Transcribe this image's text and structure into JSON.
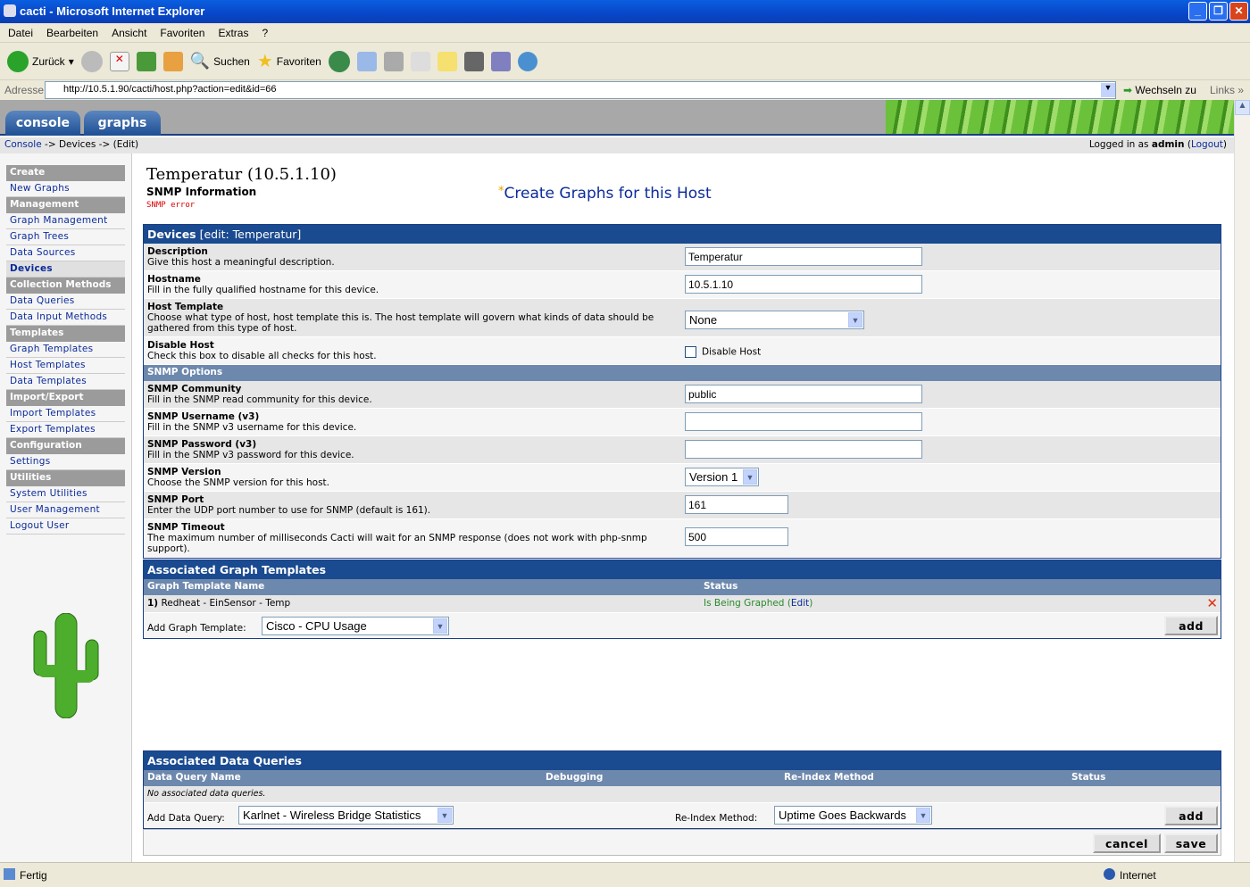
{
  "window": {
    "title": "cacti - Microsoft Internet Explorer",
    "controls": [
      "_",
      "❐",
      "✕"
    ]
  },
  "menu": [
    "Datei",
    "Bearbeiten",
    "Ansicht",
    "Favoriten",
    "Extras",
    "?"
  ],
  "toolbar": {
    "back": "Zurück",
    "search": "Suchen",
    "favorites": "Favoriten"
  },
  "address": {
    "label": "Adresse",
    "url": "http://10.5.1.90/cacti/host.php?action=edit&id=66",
    "go": "Wechseln zu",
    "links": "Links"
  },
  "tabs": [
    "console",
    "graphs"
  ],
  "breadcrumb": {
    "root": "Console",
    "rest": " -> Devices -> (Edit)",
    "logged_prefix": "Logged in as ",
    "user": "admin",
    "logout": "Logout"
  },
  "sidebar": [
    {
      "h": "Create"
    },
    {
      "i": "New Graphs"
    },
    {
      "h": "Management"
    },
    {
      "i": "Graph Management"
    },
    {
      "i": "Graph Trees"
    },
    {
      "i": "Data Sources"
    },
    {
      "i": "Devices",
      "active": true
    },
    {
      "h": "Collection Methods"
    },
    {
      "i": "Data Queries"
    },
    {
      "i": "Data Input Methods"
    },
    {
      "h": "Templates"
    },
    {
      "i": "Graph Templates"
    },
    {
      "i": "Host Templates"
    },
    {
      "i": "Data Templates"
    },
    {
      "h": "Import/Export"
    },
    {
      "i": "Import Templates"
    },
    {
      "i": "Export Templates"
    },
    {
      "h": "Configuration"
    },
    {
      "i": "Settings"
    },
    {
      "h": "Utilities"
    },
    {
      "i": "System Utilities"
    },
    {
      "i": "User Management"
    },
    {
      "i": "Logout User"
    }
  ],
  "page": {
    "title": "Temperatur (10.5.1.10)",
    "snmp_info": "SNMP Information",
    "snmp_error": "SNMP error",
    "create_star": "*",
    "create_link": "Create Graphs for this Host"
  },
  "devices": {
    "title": "Devices",
    "subtitle": " [edit: Temperatur]",
    "snmp_header": "SNMP Options",
    "fields": [
      {
        "t": "Description",
        "d": "Give this host a meaningful description.",
        "type": "text",
        "value": "Temperatur",
        "w": 266
      },
      {
        "t": "Hostname",
        "d": "Fill in the fully qualified hostname for this device.",
        "type": "text",
        "value": "10.5.1.10",
        "w": 266
      },
      {
        "t": "Host Template",
        "d": "Choose what type of host, host template this is. The host template will govern what kinds of data should be gathered from this type of host.",
        "type": "select",
        "value": "None",
        "w": 201
      },
      {
        "t": "Disable Host",
        "d": "Check this box to disable all checks for this host.",
        "type": "checkbox",
        "value": "Disable Host",
        "checked": false
      },
      {
        "t": "SNMP Community",
        "d": "Fill in the SNMP read community for this device.",
        "type": "text",
        "value": "public",
        "w": 266
      },
      {
        "t": "SNMP Username (v3)",
        "d": "Fill in the SNMP v3 username for this device.",
        "type": "text",
        "value": "",
        "w": 266
      },
      {
        "t": "SNMP Password (v3)",
        "d": "Fill in the SNMP v3 password for this device.",
        "type": "text",
        "value": "",
        "w": 266
      },
      {
        "t": "SNMP Version",
        "d": "Choose the SNMP version for this host.",
        "type": "select",
        "value": "Version 1",
        "w": 83
      },
      {
        "t": "SNMP Port",
        "d": "Enter the UDP port number to use for SNMP (default is 161).",
        "type": "text",
        "value": "161",
        "w": 116
      },
      {
        "t": "SNMP Timeout",
        "d": "The maximum number of milliseconds Cacti will wait for an SNMP response (does not work with php-snmp support).",
        "type": "text",
        "value": "500",
        "w": 116
      }
    ]
  },
  "graph_templates": {
    "title": "Associated Graph Templates",
    "col_name": "Graph Template Name",
    "col_status": "Status",
    "rows": [
      {
        "num": "1)",
        "name": "Redheat - EinSensor - Temp",
        "status": "Is Being Graphed",
        "edit": "Edit"
      }
    ],
    "add_label": "Add Graph Template:",
    "add_value": "Cisco - CPU Usage",
    "add_button": "add"
  },
  "data_queries": {
    "title": "Associated Data Queries",
    "cols": [
      "Data Query Name",
      "Debugging",
      "Re-Index Method",
      "Status"
    ],
    "empty": "No associated data queries.",
    "add_label": "Add Data Query:",
    "add_value": "Karlnet - Wireless Bridge Statistics",
    "reindex_label": "Re-Index Method:",
    "reindex_value": "Uptime Goes Backwards",
    "add_button": "add"
  },
  "actions": {
    "cancel": "cancel",
    "save": "save"
  },
  "status": {
    "left": "Fertig",
    "zone": "Internet"
  },
  "colors": {
    "header": "#1a4a8f",
    "subheader": "#6d88ad",
    "sidebar_header": "#9b9b9b",
    "link": "#0b2b9a",
    "graphed": "#2a8a2a",
    "error": "#dd0000"
  }
}
